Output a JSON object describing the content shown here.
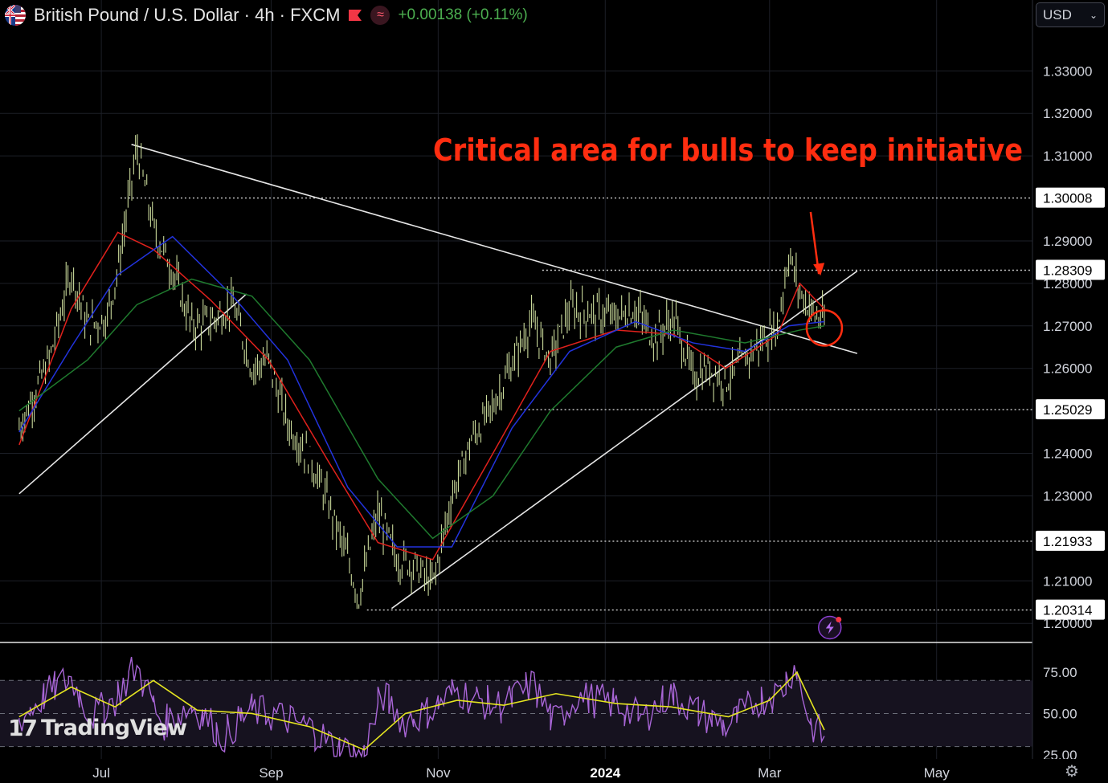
{
  "header": {
    "symbol_title": "British Pound / U.S. Dollar · 4h · FXCM",
    "change_text": "+0.00138 (+0.11%)",
    "flag_icon": "gbp-usd-flag-icon",
    "badge_icon": "red-flag-icon",
    "indicator_icon": "wave-icon"
  },
  "toolbar": {
    "currency_label": "USD"
  },
  "brand": {
    "logo_text": "TradingView"
  },
  "colors": {
    "background": "#000000",
    "up": "#4caf50",
    "price_candles": "#c9d99a",
    "ma_fast": "#e0211c",
    "ma_mid": "#2233dd",
    "ma_slow": "#1f7a2e",
    "annotation": "#ff2d10",
    "trendline": "#e6e6e6",
    "rsi_line": "#a865d6",
    "rsi_signal": "#e5e520"
  },
  "chart_data": [
    {
      "type": "line",
      "title": "",
      "x_ticks": [
        "Jul",
        "Sep",
        "Nov",
        "2024",
        "Mar",
        "May"
      ],
      "y_ticks": [
        1.33,
        1.32,
        1.31,
        1.29,
        1.28,
        1.27,
        1.26,
        1.24,
        1.23,
        1.21,
        1.2
      ],
      "y_tick_labels": [
        "1.33000",
        "1.32000",
        "1.31000",
        "1.29000",
        "1.28000",
        "1.27000",
        "1.26000",
        "1.24000",
        "1.23000",
        "1.21000",
        "1.20000"
      ],
      "ylim": [
        1.1955,
        1.3395
      ],
      "level_labels": [
        "1.30008",
        "1.28309",
        "1.25029",
        "1.21933",
        "1.20314"
      ],
      "levels": [
        1.30008,
        1.28309,
        1.25029,
        1.21933,
        1.20314
      ],
      "annotation": "Critical area for bulls to keep initiative",
      "price_series": {
        "name": "",
        "x": [
          "2023-06-01",
          "2023-06-12",
          "2023-06-20",
          "2023-06-26",
          "2023-07-03",
          "2023-07-07",
          "2023-07-14",
          "2023-07-20",
          "2023-07-27",
          "2023-08-03",
          "2023-08-10",
          "2023-08-18",
          "2023-08-25",
          "2023-08-31",
          "2023-09-07",
          "2023-09-15",
          "2023-09-22",
          "2023-09-29",
          "2023-10-03",
          "2023-10-10",
          "2023-10-17",
          "2023-10-23",
          "2023-10-30",
          "2023-11-06",
          "2023-11-13",
          "2023-11-21",
          "2023-11-28",
          "2023-12-05",
          "2023-12-12",
          "2023-12-19",
          "2023-12-27",
          "2024-01-05",
          "2024-01-12",
          "2024-01-19",
          "2024-01-26",
          "2024-02-02",
          "2024-02-08",
          "2024-02-14",
          "2024-02-21",
          "2024-02-28",
          "2024-03-04",
          "2024-03-08",
          "2024-03-12",
          "2024-03-18",
          "2024-03-21"
        ],
        "y": [
          1.246,
          1.262,
          1.283,
          1.27,
          1.272,
          1.283,
          1.312,
          1.293,
          1.283,
          1.27,
          1.271,
          1.275,
          1.26,
          1.262,
          1.247,
          1.239,
          1.228,
          1.215,
          1.206,
          1.226,
          1.215,
          1.214,
          1.209,
          1.23,
          1.243,
          1.251,
          1.261,
          1.271,
          1.262,
          1.274,
          1.273,
          1.272,
          1.274,
          1.267,
          1.272,
          1.258,
          1.26,
          1.257,
          1.262,
          1.267,
          1.27,
          1.287,
          1.278,
          1.272,
          1.271
        ]
      },
      "moving_averages": [
        {
          "name": "",
          "x": [
            "2023-06-01",
            "2023-06-20",
            "2023-07-07",
            "2023-07-20",
            "2023-08-10",
            "2023-08-31",
            "2023-09-22",
            "2023-10-10",
            "2023-10-30",
            "2023-11-21",
            "2023-12-12",
            "2024-01-05",
            "2024-01-26",
            "2024-02-14",
            "2024-03-04",
            "2024-03-12",
            "2024-03-21"
          ],
          "y": [
            1.242,
            1.274,
            1.292,
            1.288,
            1.276,
            1.262,
            1.238,
            1.219,
            1.215,
            1.24,
            1.264,
            1.269,
            1.268,
            1.26,
            1.268,
            1.28,
            1.274
          ]
        },
        {
          "name": "",
          "x": [
            "2023-06-01",
            "2023-06-20",
            "2023-07-07",
            "2023-07-27",
            "2023-08-18",
            "2023-09-07",
            "2023-09-29",
            "2023-10-17",
            "2023-11-06",
            "2023-11-28",
            "2023-12-19",
            "2024-01-12",
            "2024-02-02",
            "2024-02-21",
            "2024-03-08",
            "2024-03-21"
          ],
          "y": [
            1.245,
            1.265,
            1.282,
            1.291,
            1.277,
            1.262,
            1.232,
            1.218,
            1.218,
            1.246,
            1.264,
            1.271,
            1.266,
            1.264,
            1.27,
            1.271
          ]
        },
        {
          "name": "",
          "x": [
            "2023-06-01",
            "2023-06-26",
            "2023-07-14",
            "2023-08-03",
            "2023-08-25",
            "2023-09-15",
            "2023-10-10",
            "2023-10-30",
            "2023-11-21",
            "2023-12-12",
            "2024-01-05",
            "2024-01-26",
            "2024-02-21",
            "2024-03-12",
            "2024-03-21"
          ],
          "y": [
            1.25,
            1.262,
            1.275,
            1.281,
            1.277,
            1.262,
            1.234,
            1.22,
            1.23,
            1.25,
            1.265,
            1.269,
            1.266,
            1.269,
            1.27
          ]
        }
      ]
    },
    {
      "type": "line",
      "title": "",
      "y_ticks": [
        75,
        50,
        25
      ],
      "y_tick_labels": [
        "75.00",
        "50.00",
        "25.00"
      ],
      "ylim": [
        22.5,
        93
      ],
      "band": [
        30,
        70
      ],
      "series": [
        {
          "name": "",
          "x": [
            "2023-06-01",
            "2023-06-10",
            "2023-06-20",
            "2023-06-28",
            "2023-07-06",
            "2023-07-14",
            "2023-07-24",
            "2023-08-04",
            "2023-08-15",
            "2023-08-25",
            "2023-09-05",
            "2023-09-15",
            "2023-09-25",
            "2023-10-05",
            "2023-10-12",
            "2023-10-20",
            "2023-10-30",
            "2023-11-08",
            "2023-11-16",
            "2023-11-25",
            "2023-12-06",
            "2023-12-14",
            "2023-12-22",
            "2024-01-05",
            "2024-01-15",
            "2024-01-25",
            "2024-02-05",
            "2024-02-15",
            "2024-02-26",
            "2024-03-05",
            "2024-03-11",
            "2024-03-16",
            "2024-03-21"
          ],
          "y": [
            45,
            60,
            72,
            48,
            58,
            78,
            44,
            55,
            36,
            52,
            48,
            42,
            30,
            24,
            62,
            45,
            52,
            64,
            58,
            54,
            68,
            44,
            60,
            56,
            46,
            62,
            50,
            42,
            58,
            62,
            80,
            45,
            36
          ]
        },
        {
          "name": "",
          "x": [
            "2023-06-01",
            "2023-06-20",
            "2023-07-06",
            "2023-07-20",
            "2023-08-05",
            "2023-08-25",
            "2023-09-15",
            "2023-10-05",
            "2023-10-20",
            "2023-11-08",
            "2023-11-25",
            "2023-12-14",
            "2024-01-05",
            "2024-01-25",
            "2024-02-15",
            "2024-03-01",
            "2024-03-11",
            "2024-03-21"
          ],
          "y": [
            48,
            66,
            54,
            70,
            52,
            50,
            42,
            28,
            50,
            58,
            55,
            62,
            56,
            54,
            48,
            58,
            75,
            40
          ]
        }
      ]
    }
  ]
}
